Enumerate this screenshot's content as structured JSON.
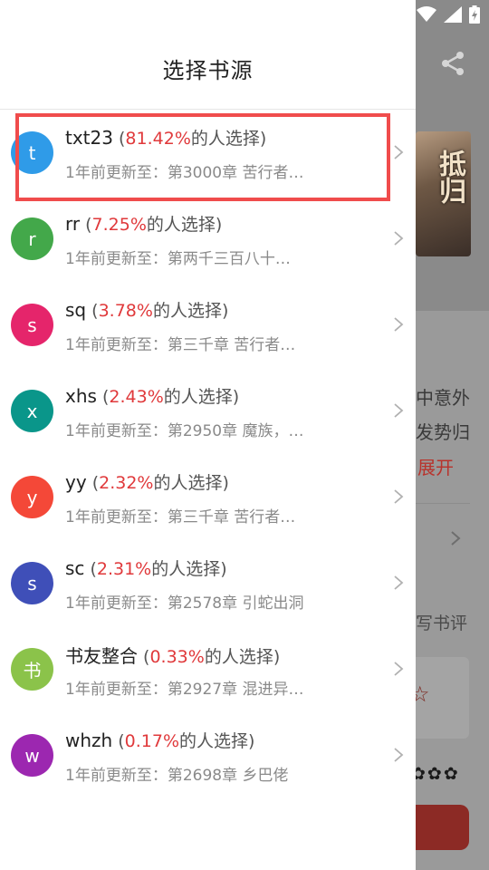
{
  "colors": {
    "percent": "#e0393b",
    "highlight_border": "#f04c4c"
  },
  "drawer": {
    "title": "选择书源"
  },
  "sources": [
    {
      "avatar": "t",
      "avatar_color": "#2f9be8",
      "name": "txt23",
      "percent": "81.42%",
      "suffix": "的人选择)",
      "update": "1年前更新至：第3000章 苦行者…"
    },
    {
      "avatar": "r",
      "avatar_color": "#43a84a",
      "name": "rr",
      "percent": "7.25%",
      "suffix": "的人选择)",
      "update": "1年前更新至：第两千三百八十…"
    },
    {
      "avatar": "s",
      "avatar_color": "#e5256b",
      "name": "sq",
      "percent": "3.78%",
      "suffix": "的人选择)",
      "update": "1年前更新至：第三千章 苦行者…"
    },
    {
      "avatar": "x",
      "avatar_color": "#0a968a",
      "name": "xhs",
      "percent": "2.43%",
      "suffix": "的人选择)",
      "update": "1年前更新至：第2950章 魔族，…"
    },
    {
      "avatar": "y",
      "avatar_color": "#f44838",
      "name": "yy",
      "percent": "2.32%",
      "suffix": "的人选择)",
      "update": "1年前更新至：第三千章 苦行者…"
    },
    {
      "avatar": "s",
      "avatar_color": "#3f4fb8",
      "name": "sc",
      "percent": "2.31%",
      "suffix": "的人选择)",
      "update": "1年前更新至：第2578章 引蛇出洞"
    },
    {
      "avatar": "书",
      "avatar_color": "#8bc34a",
      "name": "书友整合",
      "percent": "0.33%",
      "suffix": "的人选择)",
      "update": "1年前更新至：第2927章 混进异…"
    },
    {
      "avatar": "w",
      "avatar_color": "#9c27b0",
      "name": "whzh",
      "percent": "0.17%",
      "suffix": "的人选择)",
      "update": "1年前更新至：第2698章 乡巴佬"
    }
  ],
  "background": {
    "cover_title": "抵归",
    "text_line1": "中意外",
    "text_line2": "发势归",
    "expand_label": "展开",
    "review_label": "写书评",
    "stars": "✿✿✿"
  }
}
